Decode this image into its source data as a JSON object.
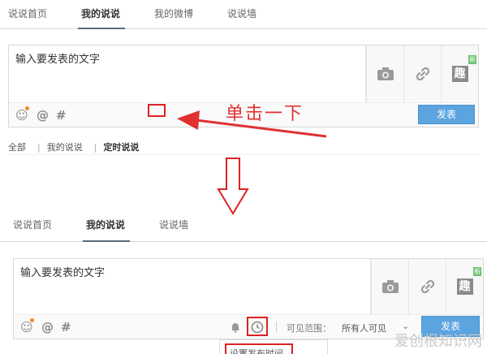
{
  "top": {
    "tabs": [
      {
        "label": "说说首页",
        "active": false
      },
      {
        "label": "我的说说",
        "active": true
      },
      {
        "label": "我的微博",
        "active": false
      },
      {
        "label": "说说墙",
        "active": false
      }
    ],
    "composer": {
      "placeholder": "输入要发表的文字",
      "send_label": "发表",
      "new_badge": "新",
      "fun_icon_char": "趣"
    },
    "annotation": "单击一下",
    "filters": {
      "all": "全部",
      "mine": "我的说说",
      "scheduled": "定时说说"
    }
  },
  "bottom": {
    "tabs": [
      {
        "label": "说说首页",
        "active": false
      },
      {
        "label": "我的说说",
        "active": true
      },
      {
        "label": "说说墙",
        "active": false
      }
    ],
    "composer": {
      "placeholder": "输入要发表的文字",
      "send_label": "发表",
      "new_badge": "新",
      "fun_icon_char": "趣",
      "visible_range_label": "可见范围：",
      "visible_range_value": "所有人可见",
      "schedule_popup": "设置发布时间"
    }
  },
  "watermark": "爱创根知识网",
  "colors": {
    "accent_blue": "#5ba4e0",
    "annotation_red": "#e03030",
    "badge_green": "#6cc26e"
  }
}
